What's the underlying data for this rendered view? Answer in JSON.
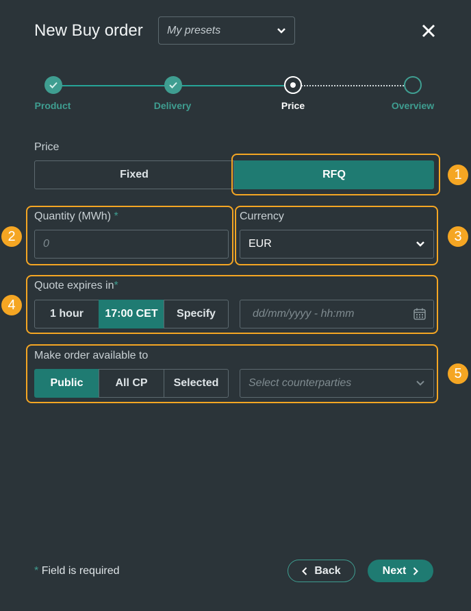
{
  "header": {
    "title": "New Buy order",
    "presets_value": "My presets"
  },
  "stepper": {
    "steps": [
      {
        "label": "Product",
        "state": "done"
      },
      {
        "label": "Delivery",
        "state": "done"
      },
      {
        "label": "Price",
        "state": "current"
      },
      {
        "label": "Overview",
        "state": "upcoming"
      }
    ]
  },
  "price": {
    "label": "Price",
    "options": [
      "Fixed",
      "RFQ"
    ],
    "selected": "RFQ"
  },
  "quantity": {
    "label": "Quantity (MWh)",
    "required_mark": "*",
    "placeholder": "0"
  },
  "currency": {
    "label": "Currency",
    "value": "EUR"
  },
  "quote_expires": {
    "label": "Quote expires in",
    "required_mark": "*",
    "options": [
      "1 hour",
      "17:00 CET",
      "Specify"
    ],
    "selected": "17:00 CET",
    "datetime_placeholder": "dd/mm/yyyy - hh:mm"
  },
  "availability": {
    "label": "Make order available to",
    "options": [
      "Public",
      "All CP",
      "Selected"
    ],
    "selected": "Public",
    "counterparties_placeholder": "Select counterparties"
  },
  "annotations": [
    "1",
    "2",
    "3",
    "4",
    "5"
  ],
  "footer": {
    "required_mark": "*",
    "required_note": "Field is required",
    "back_label": "Back",
    "next_label": "Next"
  },
  "colors": {
    "background": "#2b3439",
    "accent": "#1f7b72",
    "accent_light": "#3f9e91",
    "highlight": "#f5a623"
  }
}
